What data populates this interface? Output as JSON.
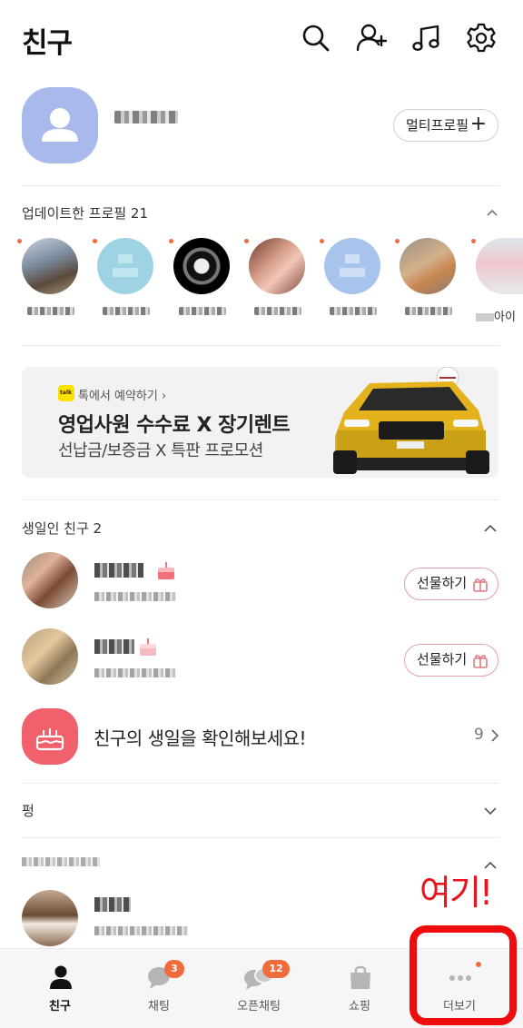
{
  "header": {
    "title": "친구",
    "icons": [
      "search-icon",
      "add-friend-icon",
      "music-icon",
      "settings-icon"
    ]
  },
  "my_profile": {
    "multi_profile_label": "멀티프로필",
    "multi_profile_plus": "+"
  },
  "updated_profiles": {
    "title": "업데이트한 프로필 21",
    "partial_last_name": "아이"
  },
  "ad": {
    "badge": "talk",
    "small": "톡에서 예약하기 ›",
    "title": "영업사원 수수료 X 장기렌트",
    "subtitle": "선납금/보증금 X 특판 프로모션"
  },
  "birthday": {
    "title": "생일인 친구 2",
    "gift_label": "선물하기",
    "check_label": "친구의 생일을 확인해보세요!",
    "check_count": "9"
  },
  "sections": {
    "pyeong": "펑"
  },
  "annotation": {
    "text": "여기!"
  },
  "tabs": [
    {
      "label": "친구",
      "icon": "person-icon",
      "active": true
    },
    {
      "label": "채팅",
      "icon": "chat-icon",
      "badge": "3"
    },
    {
      "label": "오픈채팅",
      "icon": "open-chat-icon",
      "badge": "12"
    },
    {
      "label": "쇼핑",
      "icon": "shopping-bag-icon"
    },
    {
      "label": "더보기",
      "icon": "more-icon",
      "dot": true
    }
  ],
  "colors": {
    "accent_badge": "#f26b3a",
    "cake_bg": "#f0616b",
    "annotation_red": "#e8141d",
    "my_avatar": "#a9b9ec"
  }
}
